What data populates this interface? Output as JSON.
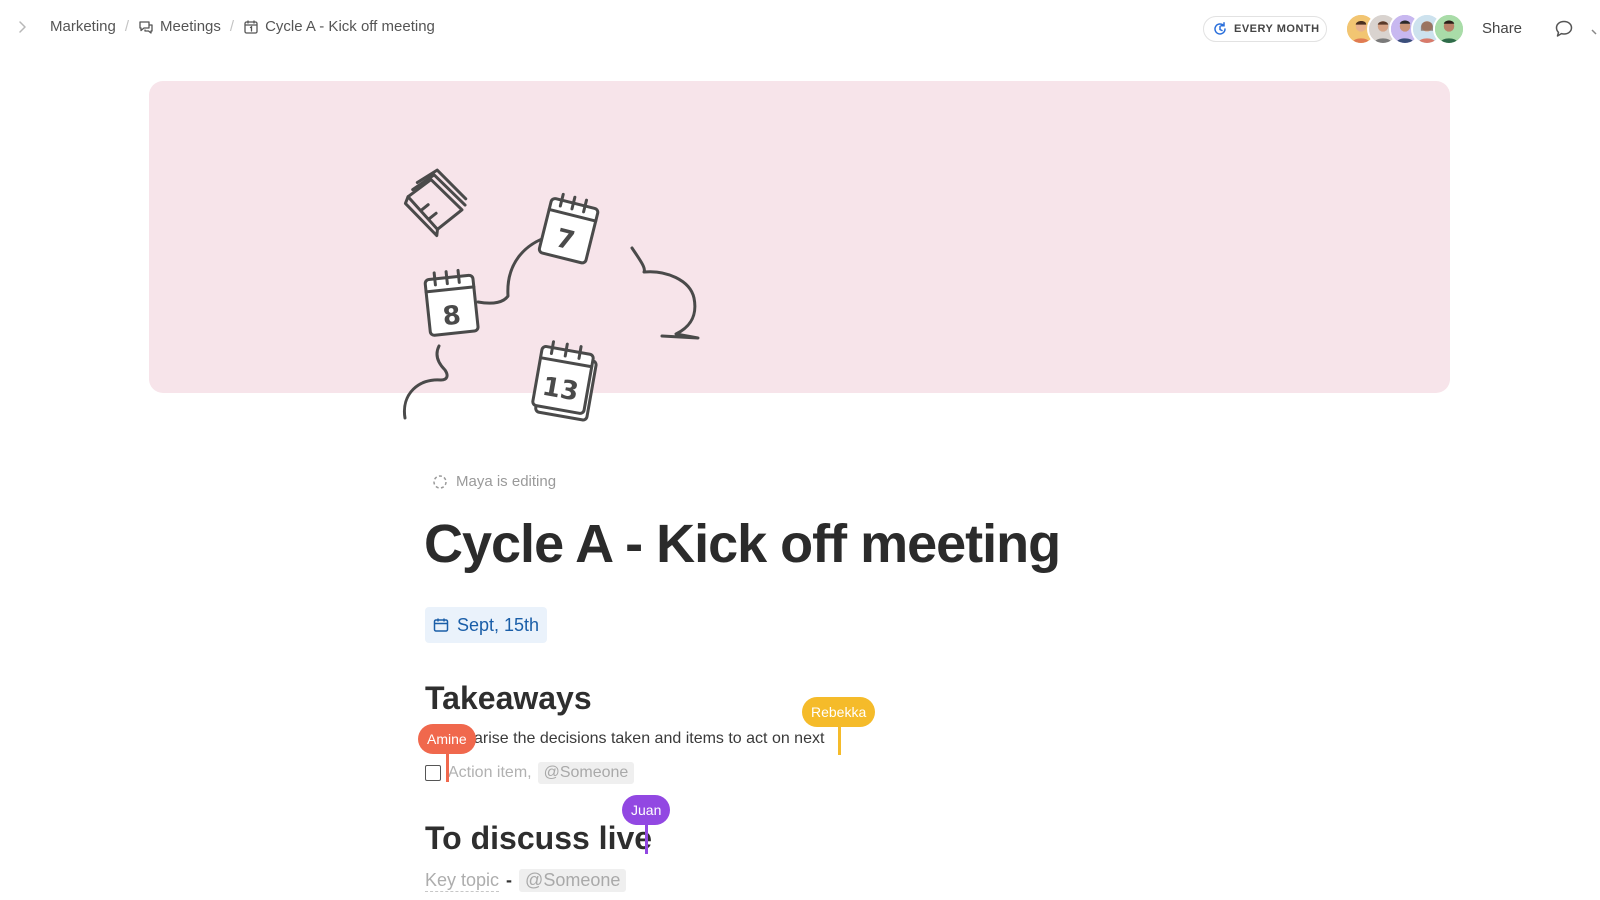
{
  "breadcrumb": {
    "items": [
      {
        "label": "Marketing"
      },
      {
        "label": "Meetings"
      },
      {
        "label": "Cycle A - Kick off meeting"
      }
    ],
    "separator": "/"
  },
  "toolbar": {
    "recurrence_label": "EVERY MONTH",
    "share_label": "Share"
  },
  "document": {
    "editing_status": "Maya is editing",
    "title": "Cycle A - Kick off meeting",
    "date": "Sept, 15th",
    "sections": [
      {
        "heading": "Takeaways",
        "paragraph": "arise the decisions taken and items to act on next",
        "action_item_placeholder": "Action item,",
        "action_item_mention": "@Someone"
      },
      {
        "heading": "To discuss live",
        "key_topic": "Key topic",
        "dash": "-",
        "mention": "@Someone"
      }
    ]
  },
  "collaborators": [
    {
      "name": "Amine",
      "color": "#f0684d"
    },
    {
      "name": "Rebekka",
      "color": "#f5bb2a"
    },
    {
      "name": "Juan",
      "color": "#9248e2"
    }
  ],
  "colors": {
    "cover_background": "#f7e4ea",
    "date_chip_text": "#1a5ea8",
    "date_chip_background": "#eaf2fb"
  },
  "icons": {
    "sidebar_toggle": "chevron-right-icon",
    "meetings": "chat-bubbles-icon",
    "calendar": "calendar-icon",
    "recurrence": "refresh-icon",
    "comment": "comment-icon",
    "editing": "spinner-icon"
  }
}
